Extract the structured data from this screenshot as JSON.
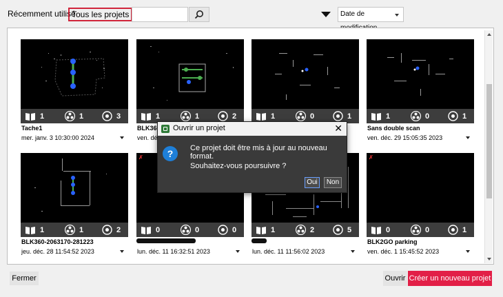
{
  "toolbar": {
    "tab_recent": "Récemment utilisé",
    "tab_all": "Tous les projets",
    "search_value": "",
    "sort_label": "Date de modification"
  },
  "cards": [
    {
      "title": "Tache1",
      "date": "mer. janv. 3 10:30:00 2024",
      "stat1": "1",
      "stat2": "1",
      "stat3": "3"
    },
    {
      "title": "BLK360",
      "date": "ven. déc.",
      "stat1": "1",
      "stat2": "1",
      "stat3": "2"
    },
    {
      "title": "",
      "date": "",
      "stat1": "1",
      "stat2": "0",
      "stat3": "1"
    },
    {
      "title": "Sans double scan",
      "date": "ven. déc. 29 15:05:35 2023",
      "stat1": "1",
      "stat2": "0",
      "stat3": "1"
    },
    {
      "title": "BLK360-2063170-281223",
      "date": "jeu. déc. 28 11:54:52 2023",
      "stat1": "1",
      "stat2": "1",
      "stat3": "2"
    },
    {
      "title": "",
      "date": "lun. déc. 11 16:32:51 2023",
      "stat1": "0",
      "stat2": "0",
      "stat3": "0"
    },
    {
      "title": "",
      "date": "lun. déc. 11 11:56:02 2023",
      "stat1": "1",
      "stat2": "2",
      "stat3": "5"
    },
    {
      "title": "BLK2GO parking",
      "date": "ven. déc. 1 15:45:52 2023",
      "stat1": "0",
      "stat2": "0",
      "stat3": "1"
    }
  ],
  "dialog": {
    "title": "Ouvrir un projet",
    "close": "✕",
    "icon": "?",
    "message": "Ce projet doit être mis à jour au nouveau format.",
    "question": "Souhaitez-vous poursuivre ?",
    "yes": "Oui",
    "no": "Non"
  },
  "footer": {
    "close": "Fermer",
    "open": "Ouvrir",
    "create": "Créer un nouveau projet"
  },
  "colors": {
    "accent": "#e21f47",
    "dialog_bg": "#3a3a3a",
    "selection_border": "#d0243a"
  }
}
